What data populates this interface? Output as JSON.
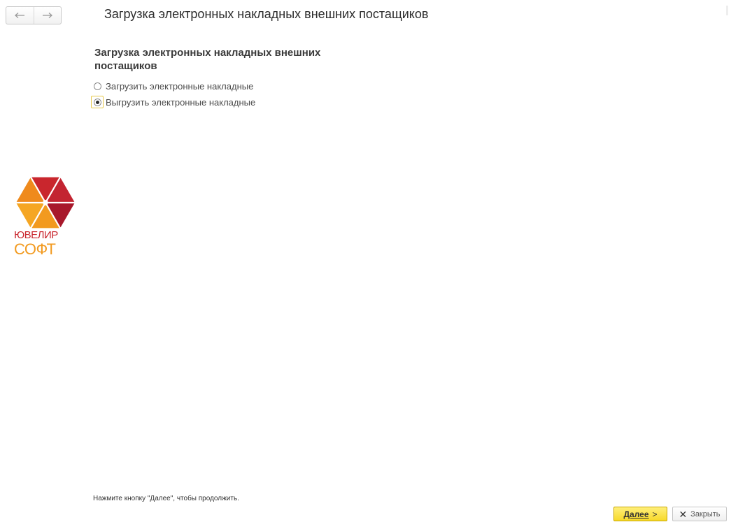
{
  "header": {
    "title": "Загрузка электронных накладных внешних постащиков",
    "back_icon": "arrow-left-icon",
    "forward_icon": "arrow-right-icon"
  },
  "form": {
    "section_title": "Загрузка электронных накладных внешних постащиков",
    "options": [
      {
        "label": "Загрузить электронные накладные",
        "selected": false
      },
      {
        "label": "Выгрузить электронные накладные",
        "selected": true
      }
    ]
  },
  "logo": {
    "line1": "ЮВЕЛИР",
    "line2": "СОФТ",
    "colors": {
      "red": "#c9262d",
      "orange": "#f29a1f",
      "dark_red": "#a8182b"
    }
  },
  "footer": {
    "hint": "Нажмите кнопку \"Далее\", чтобы продолжить.",
    "next_label": "Далее",
    "next_arrow": ">",
    "close_label": "Закрыть",
    "close_icon": "close-icon"
  },
  "colors": {
    "accent_button": "#f7d92a",
    "focus_border": "#e7c84a"
  }
}
